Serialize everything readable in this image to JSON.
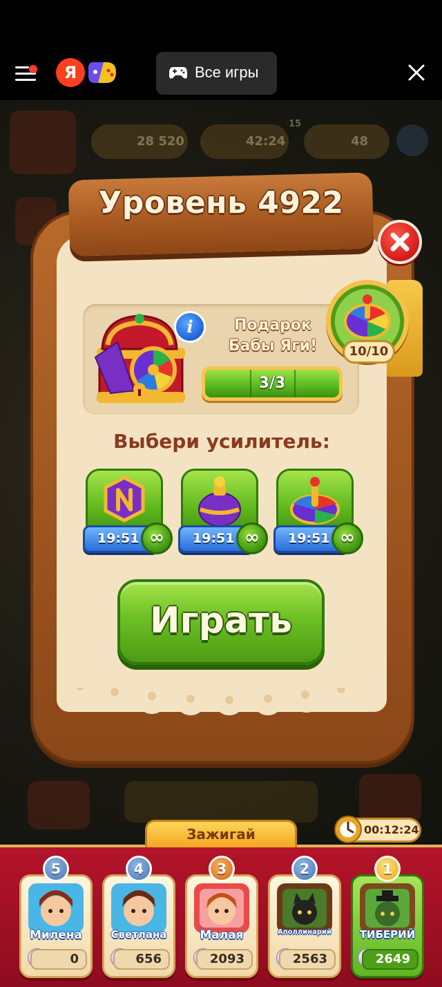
{
  "browser": {
    "ya_label": "Я",
    "all_games_label": "Все игры"
  },
  "background_hud": {
    "coins": "28 520",
    "lives": "42:24",
    "lives_badge": "15",
    "stars": "48"
  },
  "dialog": {
    "title": "Уровень 4922",
    "gift": {
      "title_line1": "Подарок",
      "title_line2": "Бабы Яги!",
      "progress_text": "3/3",
      "progress_fraction": 1.0,
      "info_label": "i"
    },
    "wheel": {
      "count": "10/10"
    },
    "choose_title": "Выбери усилитель:",
    "boosters": [
      {
        "icon": "hexagon-bomb-icon",
        "timer": "19:51",
        "count": "∞"
      },
      {
        "icon": "color-vase-icon",
        "timer": "19:51",
        "count": "∞"
      },
      {
        "icon": "spinning-top-icon",
        "timer": "19:51",
        "count": "∞"
      }
    ],
    "play_label": "Играть"
  },
  "leaderboard": {
    "tab_label": "Зажигай",
    "timer": "00:12:24",
    "players": [
      {
        "rank": "5",
        "name": "Милена",
        "score": "0"
      },
      {
        "rank": "4",
        "name": "Светлана",
        "score": "656"
      },
      {
        "rank": "3",
        "name": "Малая",
        "score": "2093"
      },
      {
        "rank": "2",
        "name": "Аполлинарий",
        "score": "2563"
      },
      {
        "rank": "1",
        "name": "ТИБЕРИЙ",
        "score": "2649"
      }
    ]
  },
  "colors": {
    "frame_wood": "#a85a22",
    "parchment": "#f4e3c3",
    "play_green": "#6cc024",
    "leaderboard_red": "#b3142a",
    "accent_gold": "#f2a822"
  }
}
